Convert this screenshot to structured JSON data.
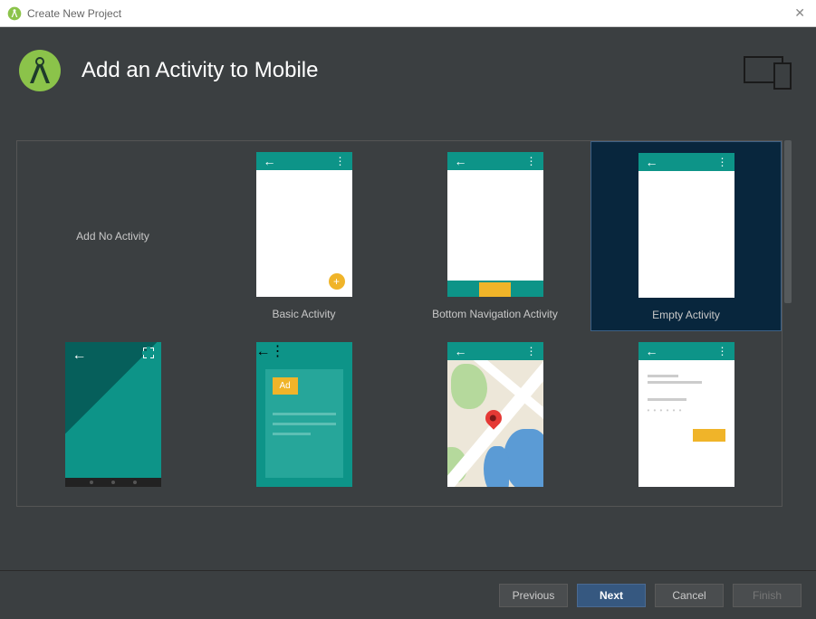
{
  "window": {
    "title": "Create New Project"
  },
  "header": {
    "title": "Add an Activity to Mobile"
  },
  "templates": [
    {
      "label": "Add No Activity",
      "type": "none"
    },
    {
      "label": "Basic Activity",
      "type": "basic"
    },
    {
      "label": "Bottom Navigation Activity",
      "type": "bottomnav"
    },
    {
      "label": "Empty Activity",
      "type": "empty",
      "selected": true
    },
    {
      "label": "",
      "type": "fullscreen"
    },
    {
      "label": "",
      "type": "admob",
      "ad_text": "Ad"
    },
    {
      "label": "",
      "type": "maps"
    },
    {
      "label": "",
      "type": "login"
    }
  ],
  "footer": {
    "previous": "Previous",
    "next": "Next",
    "cancel": "Cancel",
    "finish": "Finish"
  }
}
